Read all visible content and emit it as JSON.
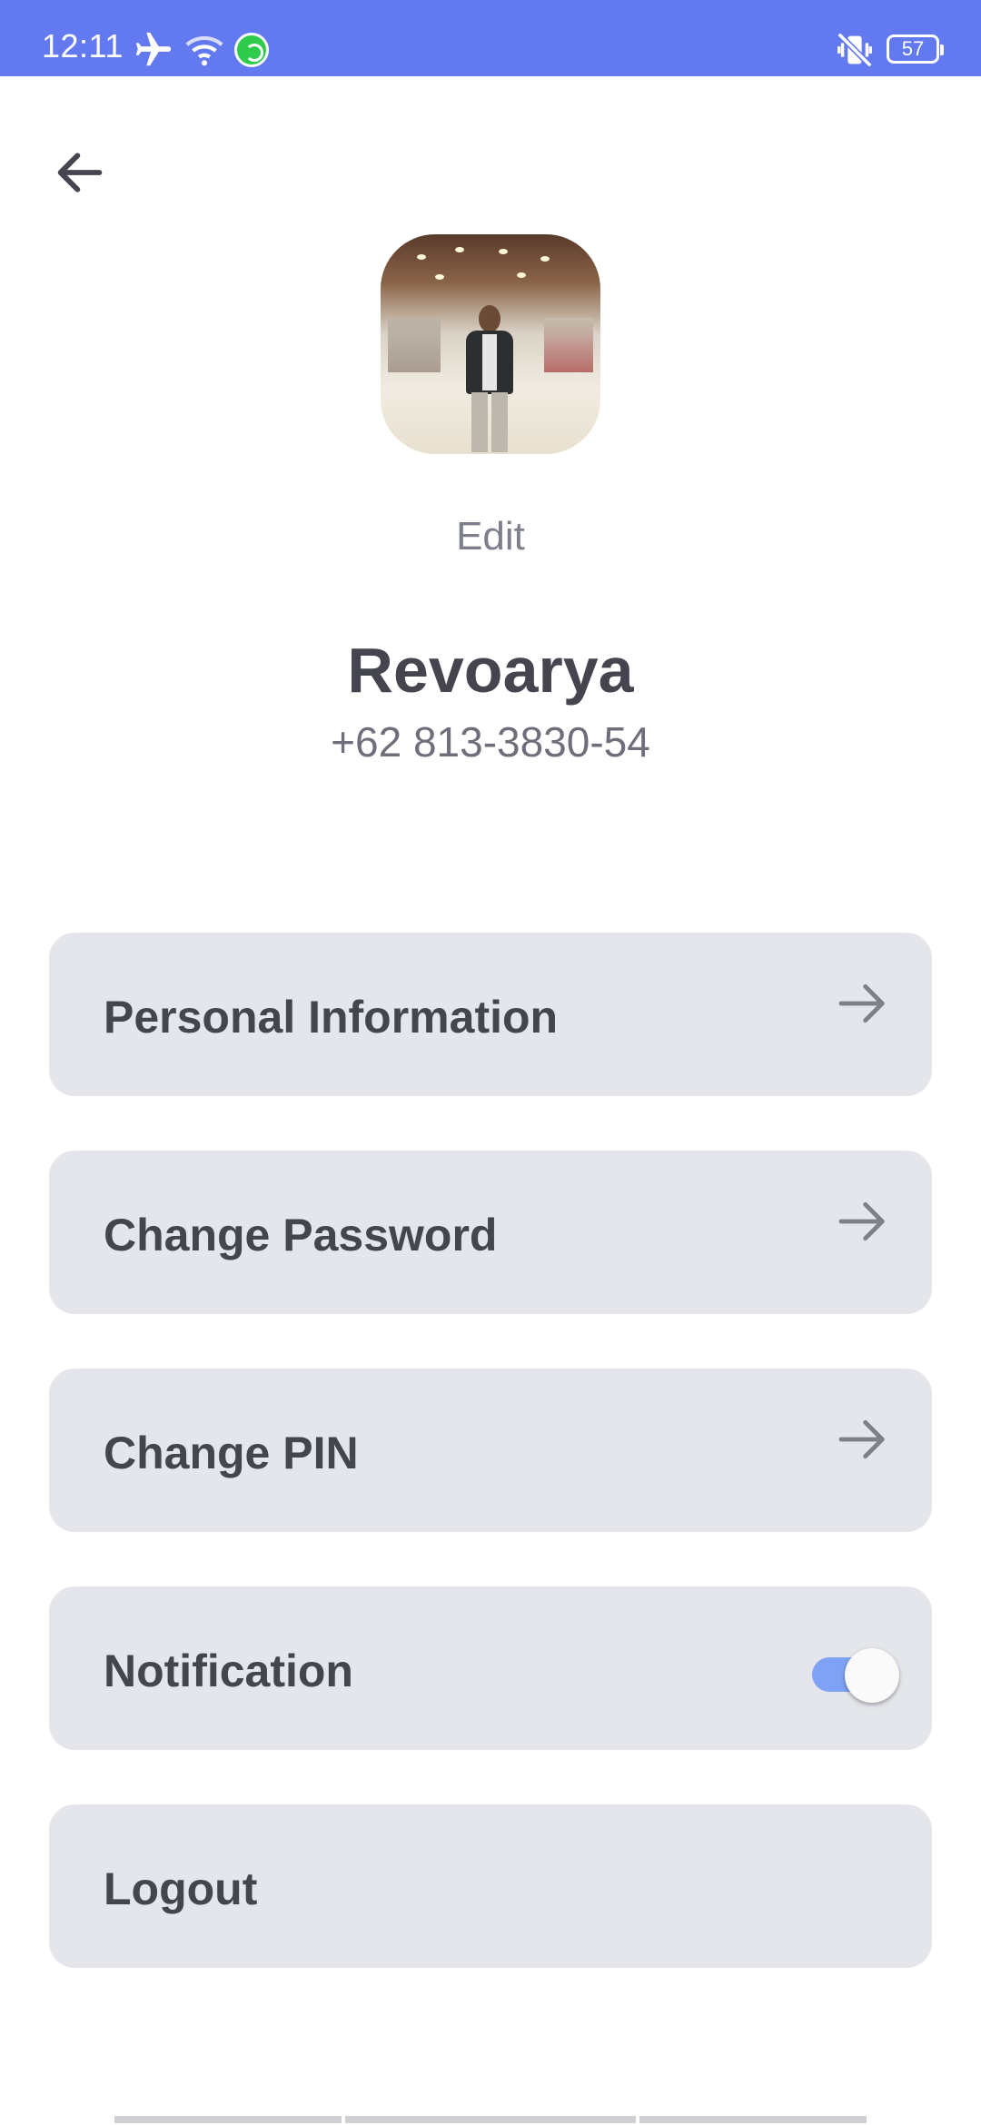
{
  "status_bar": {
    "time": "12:11",
    "icons": [
      "airplane-icon",
      "wifi-icon",
      "whatsapp-icon",
      "vibrate-icon"
    ],
    "battery": "57",
    "background": "#6279F0"
  },
  "header": {
    "back_icon": "arrow-left-icon"
  },
  "profile": {
    "edit_label": "Edit",
    "name": "Revoarya",
    "phone": "+62 813-3830-54"
  },
  "menu": {
    "personal_information": "Personal Information",
    "change_password": "Change Password",
    "change_pin": "Change PIN",
    "notification": "Notification",
    "notification_enabled": true,
    "logout": "Logout"
  },
  "colors": {
    "accent": "#6279F0",
    "card_bg": "#E4E6EB",
    "text_dark": "#45454F",
    "toggle_on": "#7FA2F5"
  }
}
